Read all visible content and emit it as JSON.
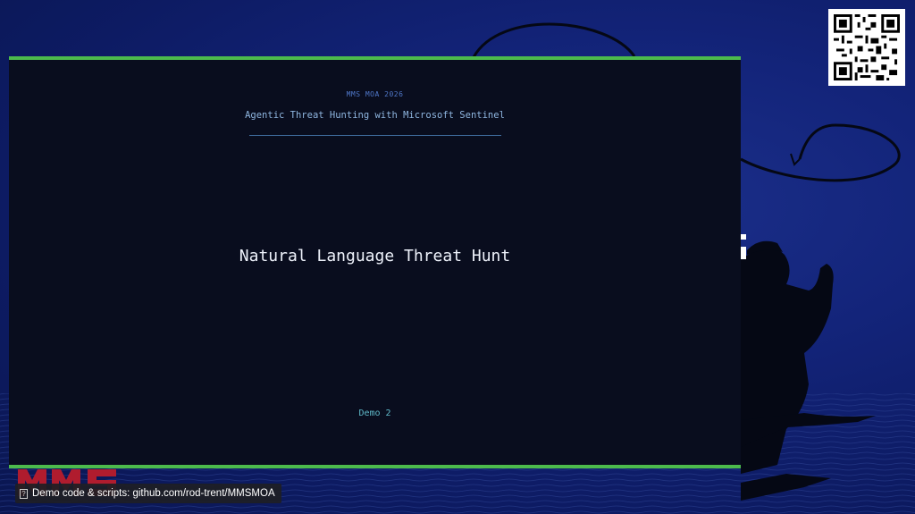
{
  "slide": {
    "background_color": "#13247a",
    "accent_color": "#4cbb4c"
  },
  "terminal": {
    "event_label": "MMS MOA 2026",
    "subtitle": "Agentic Threat Hunting with Microsoft Sentinel",
    "title": "Natural Language Threat Hunt",
    "demo_label": "Demo 2"
  },
  "footer": {
    "icon": "placeholder-glyph-icon",
    "icon_glyph": "?",
    "text": "Demo code & scripts: github.com/rod-trent/MMSMOA"
  },
  "qr": {
    "icon": "qr-code-icon"
  },
  "logo": {
    "icon": "mms-logo-icon"
  }
}
